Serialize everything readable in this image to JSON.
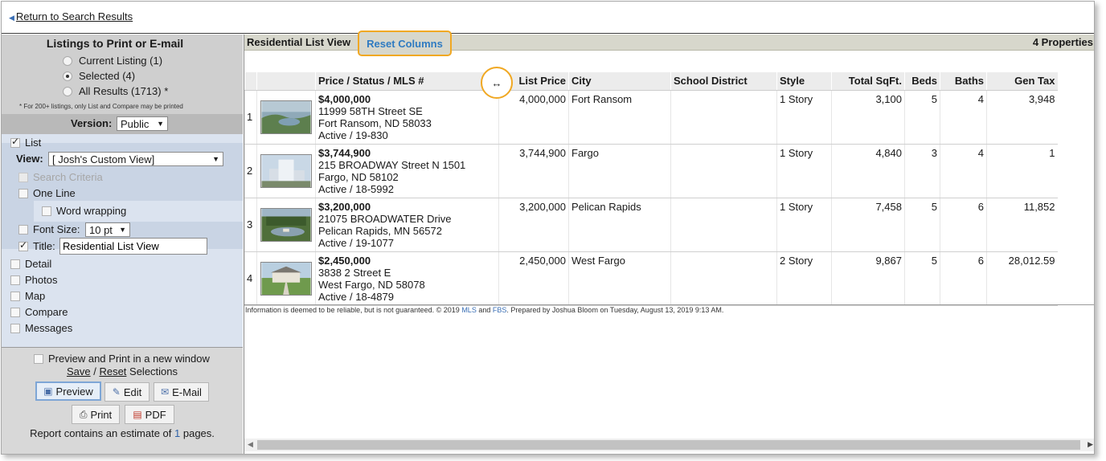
{
  "top": {
    "return_link": "Return to Search Results"
  },
  "sidebar": {
    "title": "Listings to Print or E-mail",
    "radios": [
      {
        "label": "Current Listing (1)",
        "selected": false
      },
      {
        "label": "Selected (4)",
        "selected": true
      },
      {
        "label": "All Results (1713) *",
        "selected": false
      }
    ],
    "note": "* For 200+ listings, only List and Compare may be printed",
    "version_label": "Version:",
    "version_value": "Public",
    "list_label": "List",
    "view_label": "View:",
    "view_value": "[ Josh's Custom View]",
    "search_criteria_label": "Search Criteria",
    "one_line_label": "One Line",
    "word_wrapping_label": "Word wrapping",
    "font_size_label": "Font Size:",
    "font_size_value": "10 pt",
    "title_label": "Title:",
    "title_value": "Residential List View",
    "sections": [
      "Detail",
      "Photos",
      "Map",
      "Compare",
      "Messages"
    ],
    "preview_new_window": "Preview and Print in a new window",
    "save_label": "Save",
    "separator": " / ",
    "reset_label": "Reset",
    "selections_label": " Selections",
    "buttons": {
      "preview": "Preview",
      "edit": "Edit",
      "email": "E-Mail",
      "print": "Print",
      "pdf": "PDF"
    },
    "estimate_prefix": "Report contains an estimate of ",
    "estimate_pages": "1",
    "estimate_suffix": " pages."
  },
  "main": {
    "header_title": "Residential List View",
    "reset_columns": "Reset Columns",
    "property_count": "4 Properties",
    "columns": [
      "",
      "",
      "Price / Status / MLS #",
      "List Price",
      "City",
      "School District",
      "Style",
      "Total SqFt.",
      "Beds",
      "Baths",
      "Gen Tax"
    ],
    "rows": [
      {
        "num": "1",
        "price": "$4,000,000",
        "address": "11999 58TH Street SE",
        "city_line": "Fort Ransom, ND 58033",
        "status": "Active / 19-830",
        "list_price": "4,000,000",
        "city": "Fort Ransom",
        "school": "",
        "style": "1 Story",
        "sqft": "3,100",
        "beds": "5",
        "baths": "4",
        "tax": "3,948"
      },
      {
        "num": "2",
        "price": "$3,744,900",
        "address": "215 BROADWAY Street N 1501",
        "city_line": "Fargo, ND 58102",
        "status": "Active / 18-5992",
        "list_price": "3,744,900",
        "city": "Fargo",
        "school": "",
        "style": "1 Story",
        "sqft": "4,840",
        "beds": "3",
        "baths": "4",
        "tax": "1"
      },
      {
        "num": "3",
        "price": "$3,200,000",
        "address": "21075 BROADWATER Drive",
        "city_line": "Pelican Rapids, MN 56572",
        "status": "Active / 19-1077",
        "list_price": "3,200,000",
        "city": "Pelican Rapids",
        "school": "",
        "style": "1 Story",
        "sqft": "7,458",
        "beds": "5",
        "baths": "6",
        "tax": "11,852"
      },
      {
        "num": "4",
        "price": "$2,450,000",
        "address": "3838 2 Street E",
        "city_line": "West Fargo, ND 58078",
        "status": "Active / 18-4879",
        "list_price": "2,450,000",
        "city": "West Fargo",
        "school": "",
        "style": "2 Story",
        "sqft": "9,867",
        "beds": "5",
        "baths": "6",
        "tax": "28,012.59"
      }
    ],
    "disclaimer_pre": "Information is deemed to be reliable, but is not guaranteed. © 2019 ",
    "disclaimer_mls": "MLS",
    "disclaimer_and": " and ",
    "disclaimer_fbs": "FBS",
    "disclaimer_post": ". Prepared by Joshua Bloom on Tuesday, August 13, 2019 9:13 AM.",
    "resize_glyph": "↔"
  },
  "colors": {
    "accent_highlight": "#f0a823",
    "link_blue": "#2f7bc2",
    "sidebar_blue": "#dbe3ef"
  }
}
